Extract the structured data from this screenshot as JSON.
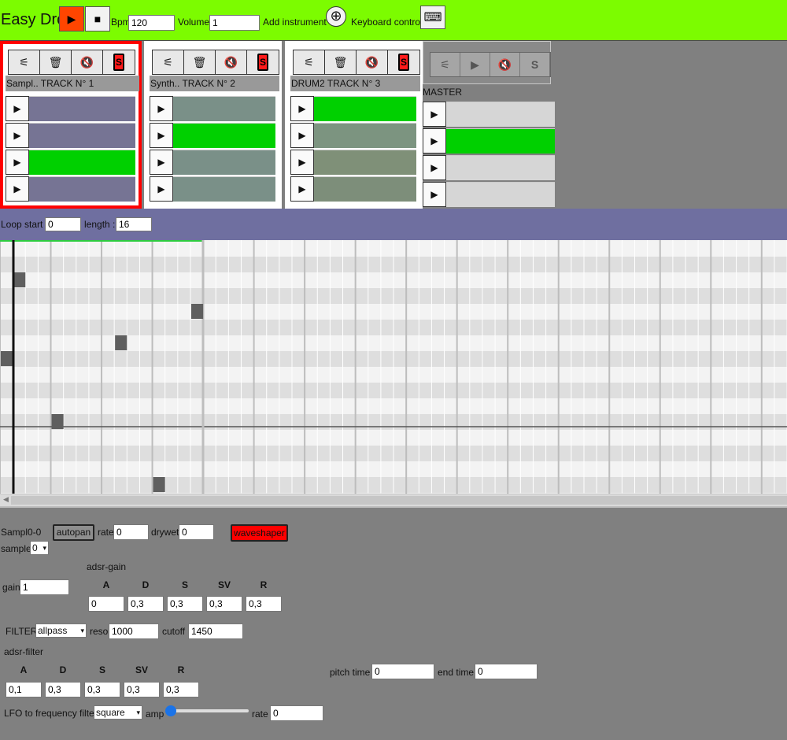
{
  "toolbar": {
    "title": "Easy Drop",
    "play_glyph": "▶",
    "stop_glyph": "■",
    "bpm_label": "Bpm",
    "bpm_value": "120",
    "volume_label": "Volume",
    "volume_value": "1",
    "add_instrument_label": "Add instrument",
    "add_glyph": "⊕",
    "keyboard_label": "Keyboard control",
    "keyboard_glyph": "⌨"
  },
  "icons": {
    "settings": "⚟",
    "delete": "🗑",
    "mute": "🔇",
    "solo": "S",
    "play": "▶"
  },
  "tracks": [
    {
      "name": "Sampl.. TRACK N° 1",
      "selected": true,
      "clips": [
        {
          "color": "#767494"
        },
        {
          "color": "#767494"
        },
        {
          "color": "#00d000"
        },
        {
          "color": "#767494"
        }
      ]
    },
    {
      "name": "Synth.. TRACK N° 2",
      "selected": false,
      "clips": [
        {
          "color": "#7a9088"
        },
        {
          "color": "#00d000"
        },
        {
          "color": "#7a9088"
        },
        {
          "color": "#7a9088"
        }
      ]
    },
    {
      "name": "DRUM2 TRACK N° 3",
      "selected": false,
      "clips": [
        {
          "color": "#00d000"
        },
        {
          "color": "#7c9480"
        },
        {
          "color": "#7f9078"
        },
        {
          "color": "#7d8e7a"
        }
      ]
    }
  ],
  "master": {
    "label": "MASTER",
    "clips": [
      {
        "color": "#d6d6d6"
      },
      {
        "color": "#00d000"
      },
      {
        "color": "#d6d6d6"
      },
      {
        "color": "#d6d6d6"
      }
    ]
  },
  "loop": {
    "start_label": "Loop start :",
    "start_value": "0",
    "length_label": "length :",
    "length_value": "16"
  },
  "sequencer": {
    "rows": 16,
    "steps": 62,
    "notes": [
      {
        "row": 2,
        "step": 1
      },
      {
        "row": 4,
        "step": 15
      },
      {
        "row": 6,
        "step": 9
      },
      {
        "row": 7,
        "step": 0
      },
      {
        "row": 11,
        "step": 4
      },
      {
        "row": 15,
        "step": 12
      }
    ]
  },
  "instrument": {
    "name": "Sampl0-0",
    "autopan_label": "autopan",
    "rate_label": "rate",
    "rate_value": "0",
    "drywet_label": "drywet",
    "drywet_value": "0",
    "waveshaper_label": "waveshaper",
    "sample_label": "sample",
    "sample_value": "0",
    "adsr_gain_title": "adsr-gain",
    "gain_label": "gain",
    "gain_value": "1",
    "adsr_headers": [
      "A",
      "D",
      "S",
      "SV",
      "R"
    ],
    "adsr_gain_values": [
      "0",
      "0,3",
      "0,3",
      "0,3",
      "0,3"
    ],
    "filter_label": "FILTER",
    "filter_type": "allpass",
    "reso_label": "reso",
    "reso_value": "1000",
    "cutoff_label": "cutoff",
    "cutoff_value": "1450",
    "adsr_filter_title": "adsr-filter",
    "adsr_filter_values": [
      "0,1",
      "0,3",
      "0,3",
      "0,3",
      "0,3"
    ],
    "pitch_time_label": "pitch time",
    "pitch_time_value": "0",
    "end_time_label": "end time",
    "end_time_value": "0",
    "lfo_label": "LFO to frequency filter",
    "lfo_type": "square",
    "amp_label": "amp",
    "amp_value": 0,
    "lfo_rate_label": "rate",
    "lfo_rate_value": "0"
  }
}
